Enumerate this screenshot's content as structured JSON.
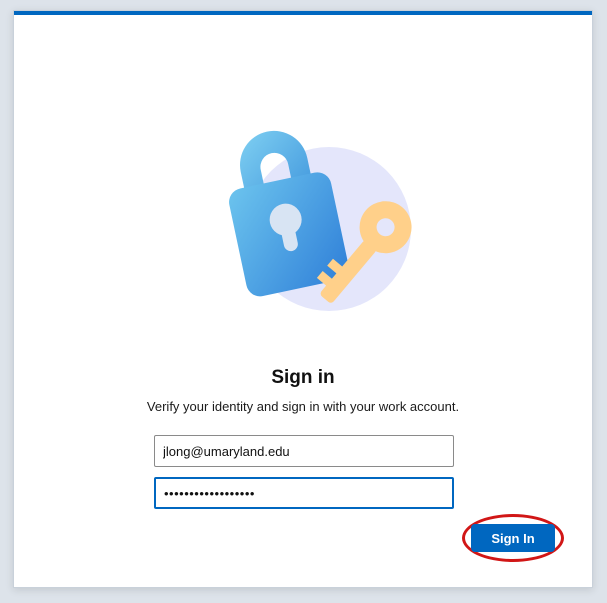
{
  "dialog": {
    "title": "Sign in",
    "subtitle": "Verify your identity and sign in with your work account.",
    "icon": "lock-and-key-icon"
  },
  "form": {
    "email_value": "jlong@umaryland.edu",
    "password_value": "••••••••••••••••••"
  },
  "actions": {
    "sign_in_label": "Sign In"
  },
  "colors": {
    "accent": "#0067c0",
    "highlight_ring": "#d11616"
  }
}
